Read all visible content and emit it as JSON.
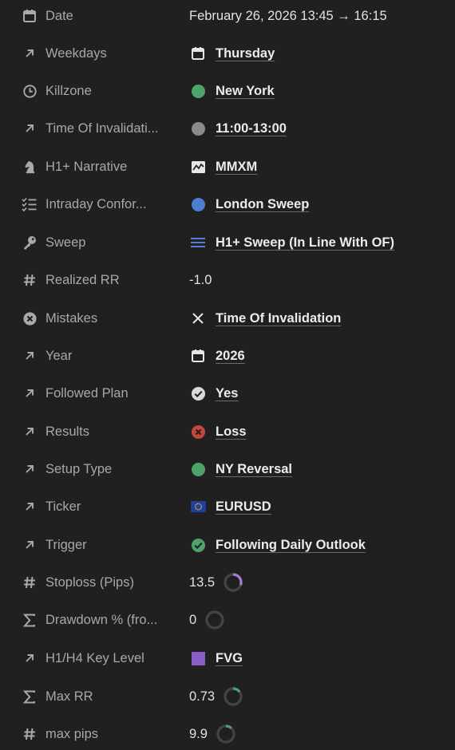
{
  "properties": [
    {
      "label": "Date",
      "icon": "calendar-icon",
      "value": "February 26, 2026 13:45 → 16:15",
      "kind": "plain"
    },
    {
      "label": "Weekdays",
      "icon": "arrow-up-right-icon",
      "value": "Thursday",
      "kind": "link",
      "value_icon": "calendar-icon"
    },
    {
      "label": "Killzone",
      "icon": "clock-icon",
      "value": "New York",
      "kind": "link",
      "value_icon": "dot",
      "color": "#4ea36a"
    },
    {
      "label": "Time Of Invalidati...",
      "icon": "arrow-up-right-icon",
      "value": "11:00-13:00",
      "kind": "link",
      "value_icon": "dot",
      "color": "#8a8a8a"
    },
    {
      "label": "H1+ Narrative",
      "icon": "chess-knight-icon",
      "value": "MMXM",
      "kind": "link",
      "value_icon": "chart-line-icon"
    },
    {
      "label": "Intraday Confor...",
      "icon": "checklist-icon",
      "value": "London Sweep",
      "kind": "link",
      "value_icon": "dot",
      "color": "#4a7fd4"
    },
    {
      "label": "Sweep",
      "icon": "key-icon",
      "value": "H1+ Sweep (In Line With OF)",
      "kind": "link",
      "value_icon": "menu-lines-icon"
    },
    {
      "label": "Realized RR",
      "icon": "hash-icon",
      "value": "-1.0",
      "kind": "plain"
    },
    {
      "label": "Mistakes",
      "icon": "circle-x-icon",
      "value": "Time Of Invalidation",
      "kind": "link",
      "value_icon": "x-icon"
    },
    {
      "label": "Year",
      "icon": "arrow-up-right-icon",
      "value": "2026",
      "kind": "link",
      "value_icon": "calendar-icon"
    },
    {
      "label": "Followed Plan",
      "icon": "arrow-up-right-icon",
      "value": "Yes",
      "kind": "link",
      "value_icon": "check-circle-icon",
      "color": "#d9d9d9"
    },
    {
      "label": "Results",
      "icon": "arrow-up-right-icon",
      "value": "Loss",
      "kind": "link",
      "value_icon": "x-circle-icon",
      "color": "#c0473a"
    },
    {
      "label": "Setup Type",
      "icon": "arrow-up-right-icon",
      "value": "NY Reversal",
      "kind": "link",
      "value_icon": "dot",
      "color": "#4ea36a"
    },
    {
      "label": "Ticker",
      "icon": "arrow-up-right-icon",
      "value": "EURUSD",
      "kind": "link",
      "value_icon": "eu-flag-icon"
    },
    {
      "label": "Trigger",
      "icon": "arrow-up-right-icon",
      "value": "Following Daily Outlook",
      "kind": "link",
      "value_icon": "check-circle-icon",
      "color": "#4ea36a"
    },
    {
      "label": "Stoploss (Pips)",
      "icon": "hash-icon",
      "value": "13.5",
      "kind": "number",
      "progress": 0.3,
      "color": "#a77bd6"
    },
    {
      "label": "Drawdown % (fro...",
      "icon": "sigma-icon",
      "value": "0",
      "kind": "number",
      "progress": 0,
      "color": "#4ea36a"
    },
    {
      "label": "H1/H4 Key Level",
      "icon": "arrow-up-right-icon",
      "value": "FVG",
      "kind": "link",
      "value_icon": "square",
      "color": "#8a5cc6"
    },
    {
      "label": "Max RR",
      "icon": "sigma-icon",
      "value": "0.73",
      "kind": "number",
      "progress": 0.15,
      "color": "#4ea36a"
    },
    {
      "label": "max pips",
      "icon": "hash-icon",
      "value": "9.9",
      "kind": "number",
      "progress": 0.12,
      "color": "#4ea36a"
    }
  ]
}
